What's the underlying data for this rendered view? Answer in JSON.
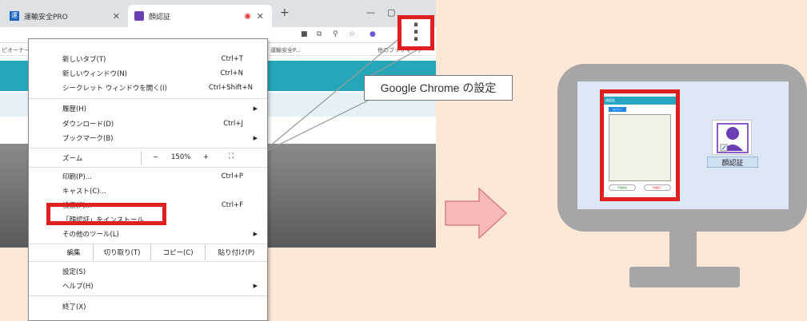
{
  "browser": {
    "tabs": [
      {
        "label": "運輸安全PRO",
        "favicon": "運"
      },
      {
        "label": "顔認証"
      }
    ],
    "bookmarks": [
      "ピオーナー",
      "運輸安全P...",
      "他のブックマーク"
    ]
  },
  "menu": {
    "items": [
      {
        "label": "新しいタブ(T)",
        "shortcut": "Ctrl+T"
      },
      {
        "label": "新しいウィンドウ(N)",
        "shortcut": "Ctrl+N"
      },
      {
        "label": "シークレット ウィンドウを開く(I)",
        "shortcut": "Ctrl+Shift+N"
      },
      {
        "label": "履歴(H)",
        "shortcut": ""
      },
      {
        "label": "ダウンロード(D)",
        "shortcut": "Ctrl+J"
      },
      {
        "label": "ブックマーク(B)",
        "shortcut": ""
      },
      {
        "label": "ズーム",
        "shortcut": ""
      },
      {
        "label": "印刷(P)...",
        "shortcut": "Ctrl+P"
      },
      {
        "label": "キャスト(C)...",
        "shortcut": ""
      },
      {
        "label": "検索(F)...",
        "shortcut": "Ctrl+F"
      },
      {
        "label": "「顔認証」をインストール...",
        "shortcut": ""
      },
      {
        "label": "その他のツール(L)",
        "shortcut": ""
      },
      {
        "label": "設定(S)",
        "shortcut": ""
      },
      {
        "label": "ヘルプ(H)",
        "shortcut": ""
      },
      {
        "label": "終了(X)",
        "shortcut": ""
      }
    ],
    "zoom": {
      "minus": "−",
      "value": "150%",
      "plus": "+",
      "fullscreen": "⛶"
    },
    "edit": {
      "label": "編集",
      "cut": "切り取り(T)",
      "copy": "コピー(C)",
      "paste": "貼り付け(P)"
    }
  },
  "tooltip": "Google Chrome の設定",
  "desktop": {
    "app_title": "顔認証",
    "app_button": "ログイン",
    "app_start": "作業開始",
    "app_end": "作業終了",
    "icon_label": "顔認証"
  },
  "colors": {
    "highlight": "#e02020",
    "background": "#fde8d8",
    "teal": "#26a7b9",
    "monitor": "#a6a6a6",
    "arrow": "#f2a0a0"
  }
}
